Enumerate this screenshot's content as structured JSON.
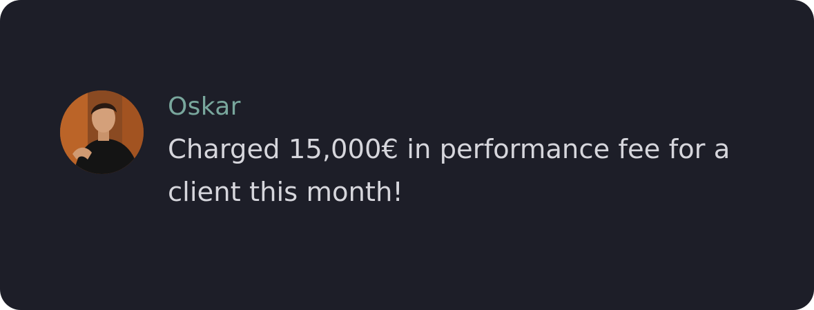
{
  "message": {
    "author": "Oskar",
    "text": "Charged 15,000€ in performance fee for a client this month!",
    "avatar_icon": "user-avatar-photo"
  },
  "colors": {
    "background": "#1d1e28",
    "author": "#79a79d",
    "text": "#d6d6dc"
  }
}
